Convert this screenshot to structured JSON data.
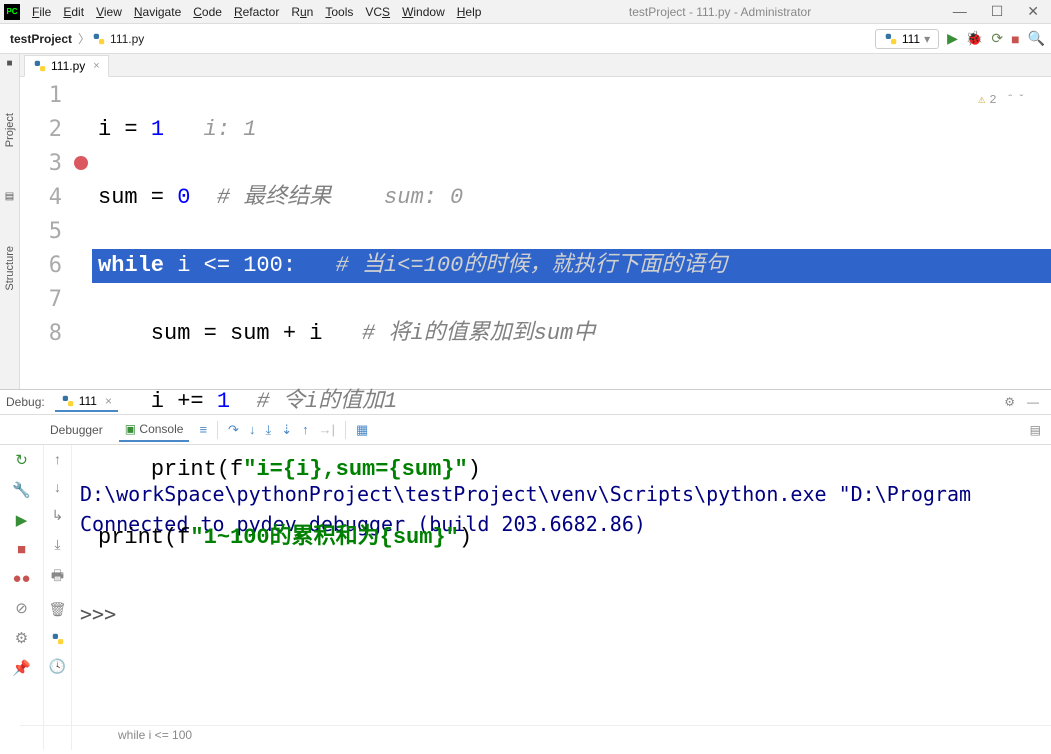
{
  "window": {
    "title": "testProject - 111.py - Administrator",
    "menu": [
      "File",
      "Edit",
      "View",
      "Navigate",
      "Code",
      "Refactor",
      "Run",
      "Tools",
      "VCS",
      "Window",
      "Help"
    ]
  },
  "navbar": {
    "project": "testProject",
    "file": "111.py"
  },
  "run_config": {
    "name": "111"
  },
  "editor": {
    "tab": "111.py",
    "lines": [
      "1",
      "2",
      "3",
      "4",
      "5",
      "6",
      "7",
      "8"
    ],
    "hint1": "i: 1",
    "hint2": "sum: 0",
    "code": {
      "l1_a": "i = ",
      "l1_b": "1",
      "l2_a": "sum = ",
      "l2_b": "0",
      "l2_c": "# 最终结果",
      "l3_a": "while",
      "l3_b": " i <= ",
      "l3_c": "100",
      "l3_d": ":",
      "l3_e": "# 当i<=100的时候，就执行下面的语句",
      "l4_a": "    sum = sum + i   ",
      "l4_b": "# 将i的值累加到sum中",
      "l5_a": "    i += ",
      "l5_b": "1",
      "l5_c": "# 令i的值加1",
      "l6_a": "    ",
      "l6_b": "print",
      "l6_c": "(f",
      "l6_d": "\"i={i},sum={sum}\"",
      "l6_e": ")",
      "l7_a": "print",
      "l7_b": "(f",
      "l7_c": "\"1~100的累积和为{sum}\"",
      "l7_d": ")"
    },
    "status": "while i <= 100",
    "warnings": "2"
  },
  "debug": {
    "label": "Debug:",
    "tab_name": "111",
    "tabs": {
      "debugger": "Debugger",
      "console": "Console"
    },
    "console_lines": {
      "l1": "D:\\workSpace\\pythonProject\\testProject\\venv\\Scripts\\python.exe \"D:\\Program",
      "l2": "Connected to pydev debugger (build 203.6682.86)",
      "prompt": ">>> "
    }
  }
}
